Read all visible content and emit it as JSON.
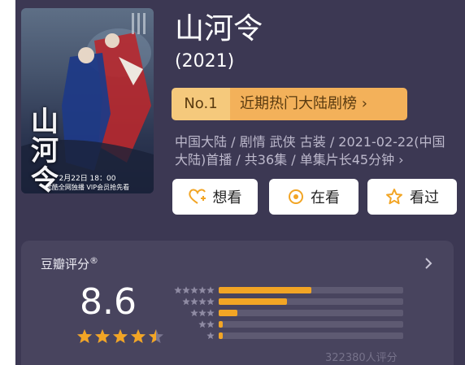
{
  "poster": {
    "title": "山河令",
    "date": "2月22日 18：00",
    "footer": "优酷全网独播 VIP会员抢先看"
  },
  "title": "山河令",
  "year": "(2021)",
  "rank": {
    "no": "No.1",
    "label": "近期热门大陆剧榜 ›"
  },
  "meta": "中国大陆 / 剧情 武侠 古装 / 2021-02-22(中国大陆)首播 / 共36集 / 单集片长45分钟 ›",
  "actions": [
    {
      "label": "想看",
      "icon": "heart-plus-icon"
    },
    {
      "label": "在看",
      "icon": "target-icon"
    },
    {
      "label": "看过",
      "icon": "star-outline-icon"
    }
  ],
  "rating": {
    "label": "豆瓣评分",
    "mark": "®",
    "score": "8.6",
    "stars_value": 4.5,
    "distribution": [
      0.5,
      0.37,
      0.1,
      0.02,
      0.02
    ],
    "votes": "322380人评分",
    "accent": "#f2a525"
  }
}
